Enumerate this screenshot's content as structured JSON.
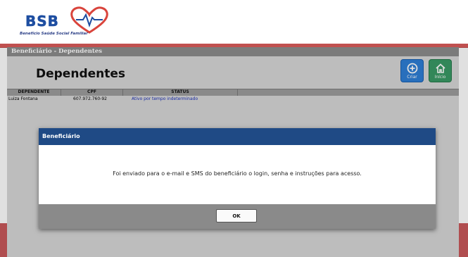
{
  "brand": {
    "logo_text": "BSB",
    "logo_subtitle": "Benefício Saúde Social Familiar",
    "heart_color": "#d9443c",
    "brand_color": "#1e4ea1"
  },
  "panel": {
    "header": "Beneficiário - Dependentes",
    "title": "Dependentes"
  },
  "actions": {
    "create_label": "Criar",
    "create_icon": "plus-circle-icon",
    "home_label": "Início",
    "home_icon": "home-icon"
  },
  "table": {
    "columns": [
      "DEPENDENTE",
      "CPF",
      "STATUS"
    ],
    "rows": [
      {
        "dependente": "Luiza Fontana",
        "cpf": "607.972.760-92",
        "status": "Ativo por tempo indeterminado"
      }
    ],
    "status_color": "#1b2fb8"
  },
  "modal": {
    "title": "Beneficiário",
    "message": "Foi enviado para o e-mail e SMS do beneficiário o login, senha e instruções para acesso.",
    "ok_label": "OK"
  }
}
